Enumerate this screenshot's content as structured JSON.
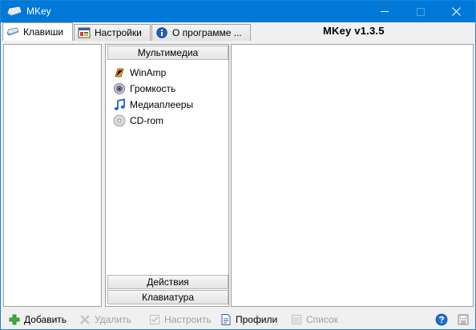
{
  "window": {
    "title": "MKey"
  },
  "tabs": [
    {
      "label": "Клавиши",
      "icon": "keyboard-icon",
      "active": true
    },
    {
      "label": "Настройки",
      "icon": "settings-icon",
      "active": false
    },
    {
      "label": "О программе ...",
      "icon": "info-icon",
      "active": false
    }
  ],
  "version_label": "MKey v1.3.5",
  "groups": {
    "multimedia": "Мультимедиа",
    "actions": "Действия",
    "keyboard": "Клавиатура"
  },
  "items": [
    {
      "label": "WinAmp",
      "icon": "winamp-icon"
    },
    {
      "label": "Громкость",
      "icon": "speaker-icon"
    },
    {
      "label": "Медиаплееры",
      "icon": "music-note-icon"
    },
    {
      "label": "CD-rom",
      "icon": "cd-icon"
    }
  ],
  "toolbar": {
    "add": "Добавить",
    "delete": "Удалить",
    "configure": "Настроить",
    "profiles": "Профили",
    "list": "Список"
  },
  "colors": {
    "titlebar": "#0078d7",
    "accent_green": "#2e9e2e",
    "help_blue": "#1f6fd1"
  }
}
